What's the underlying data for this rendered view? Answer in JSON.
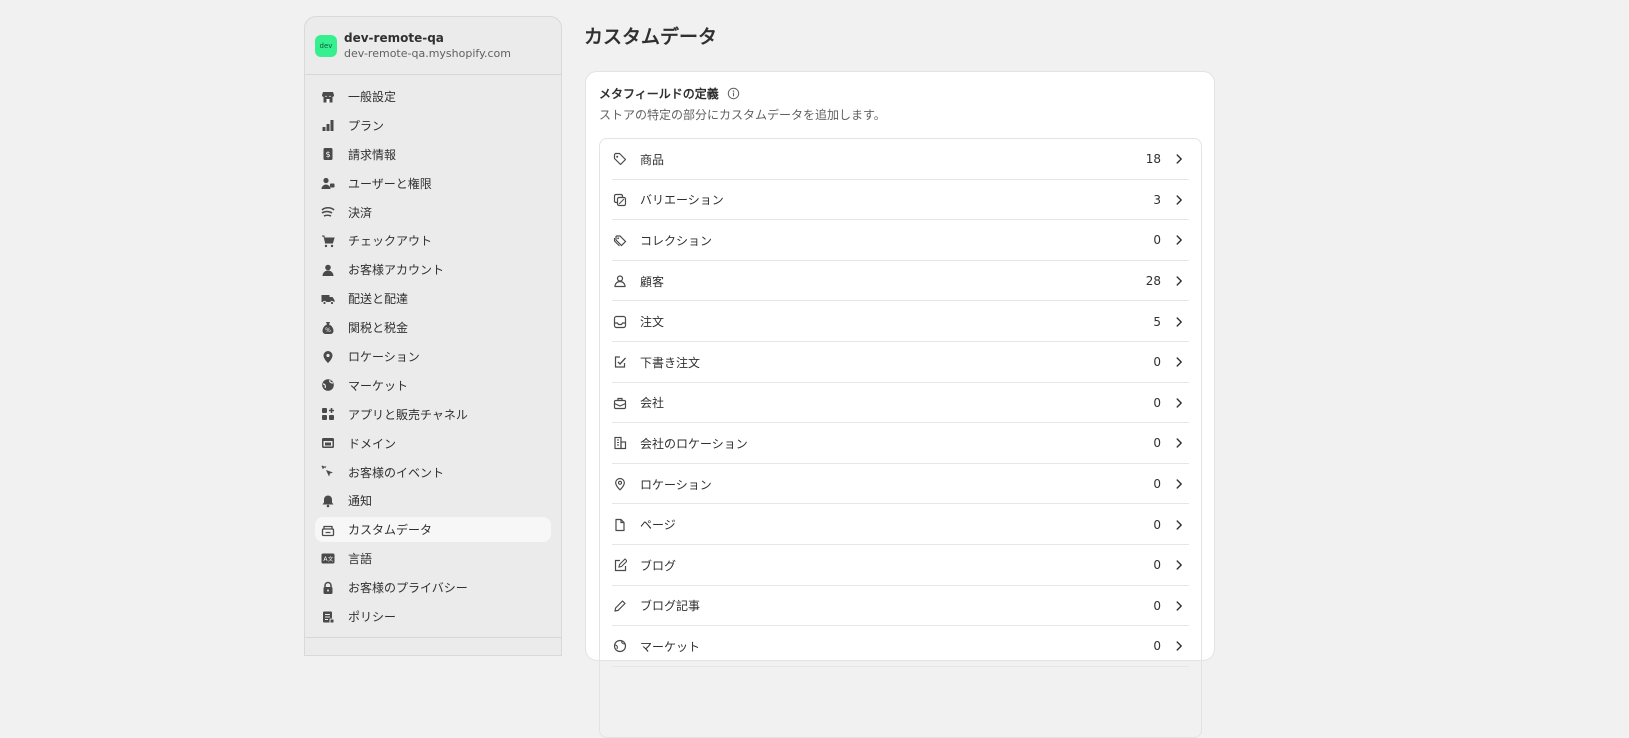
{
  "store": {
    "name": "dev-remote-qa",
    "domain": "dev-remote-qa.myshopify.com",
    "logo_text": "dev"
  },
  "sidebar": {
    "items": [
      {
        "label": "一般設定",
        "icon": "store-icon"
      },
      {
        "label": "プラン",
        "icon": "plan-icon"
      },
      {
        "label": "請求情報",
        "icon": "billing-icon"
      },
      {
        "label": "ユーザーと権限",
        "icon": "users-icon"
      },
      {
        "label": "決済",
        "icon": "payments-icon"
      },
      {
        "label": "チェックアウト",
        "icon": "cart-icon"
      },
      {
        "label": "お客様アカウント",
        "icon": "person-icon"
      },
      {
        "label": "配送と配達",
        "icon": "truck-icon"
      },
      {
        "label": "関税と税金",
        "icon": "tax-icon"
      },
      {
        "label": "ロケーション",
        "icon": "location-icon"
      },
      {
        "label": "マーケット",
        "icon": "globe-icon"
      },
      {
        "label": "アプリと販売チャネル",
        "icon": "apps-icon"
      },
      {
        "label": "ドメイン",
        "icon": "domain-icon"
      },
      {
        "label": "お客様のイベント",
        "icon": "cursor-icon"
      },
      {
        "label": "通知",
        "icon": "bell-icon"
      },
      {
        "label": "カスタムデータ",
        "icon": "custom-data-icon",
        "active": true
      },
      {
        "label": "言語",
        "icon": "language-icon"
      },
      {
        "label": "お客様のプライバシー",
        "icon": "lock-icon"
      },
      {
        "label": "ポリシー",
        "icon": "policy-icon"
      }
    ]
  },
  "main": {
    "title": "カスタムデータ",
    "card": {
      "title": "メタフィールドの定義",
      "subtitle": "ストアの特定の部分にカスタムデータを追加します。",
      "rows": [
        {
          "label": "商品",
          "count": "18",
          "icon": "tag-icon"
        },
        {
          "label": "バリエーション",
          "count": "3",
          "icon": "variant-icon"
        },
        {
          "label": "コレクション",
          "count": "0",
          "icon": "collection-icon"
        },
        {
          "label": "顧客",
          "count": "28",
          "icon": "person-icon"
        },
        {
          "label": "注文",
          "count": "5",
          "icon": "inbox-icon"
        },
        {
          "label": "下書き注文",
          "count": "0",
          "icon": "draft-order-icon"
        },
        {
          "label": "会社",
          "count": "0",
          "icon": "company-icon"
        },
        {
          "label": "会社のロケーション",
          "count": "0",
          "icon": "building-icon"
        },
        {
          "label": "ロケーション",
          "count": "0",
          "icon": "location-icon"
        },
        {
          "label": "ページ",
          "count": "0",
          "icon": "page-icon"
        },
        {
          "label": "ブログ",
          "count": "0",
          "icon": "blog-icon"
        },
        {
          "label": "ブログ記事",
          "count": "0",
          "icon": "pencil-icon"
        },
        {
          "label": "マーケット",
          "count": "0",
          "icon": "globe-icon"
        }
      ]
    }
  }
}
